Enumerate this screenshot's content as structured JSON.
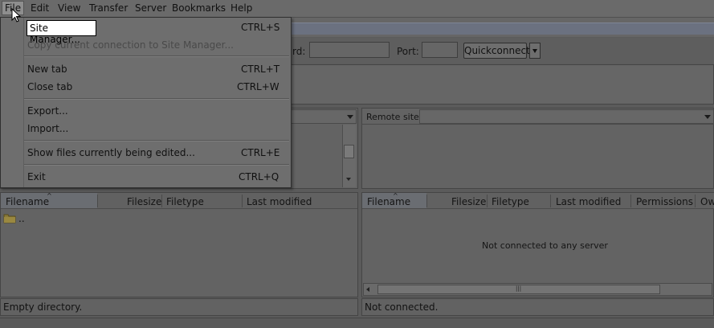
{
  "menubar": {
    "items": [
      {
        "label": "File"
      },
      {
        "label": "Edit"
      },
      {
        "label": "View"
      },
      {
        "label": "Transfer"
      },
      {
        "label": "Server"
      },
      {
        "label": "Bookmarks"
      },
      {
        "label": "Help"
      }
    ]
  },
  "file_menu": {
    "items": [
      {
        "label": "Site Manager...",
        "shortcut": "CTRL+S"
      },
      {
        "label": "Copy current connection to Site Manager...",
        "shortcut": ""
      },
      {
        "label": "New tab",
        "shortcut": "CTRL+T"
      },
      {
        "label": "Close tab",
        "shortcut": "CTRL+W"
      },
      {
        "label": "Export...",
        "shortcut": ""
      },
      {
        "label": "Import...",
        "shortcut": ""
      },
      {
        "label": "Show files currently being edited...",
        "shortcut": "CTRL+E"
      },
      {
        "label": "Exit",
        "shortcut": "CTRL+Q"
      }
    ]
  },
  "quickconnect": {
    "password_label": "rd:",
    "port_label": "Port:",
    "password_value": "",
    "port_value": "",
    "button_label": "Quickconnect"
  },
  "remote": {
    "site_label": "Remote site:",
    "site_value": "",
    "columns": [
      "Filename",
      "Filesize",
      "Filetype",
      "Last modified",
      "Permissions",
      "Ow"
    ],
    "empty_message": "Not connected to any server",
    "status": "Not connected."
  },
  "local": {
    "columns": [
      "Filename",
      "Filesize",
      "Filetype",
      "Last modified"
    ],
    "rows": [
      {
        "name": ".."
      }
    ],
    "status": "Empty directory."
  },
  "colors": {
    "menu_highlight": "#ffffff",
    "overlay_gray": "#5b5b5b"
  }
}
